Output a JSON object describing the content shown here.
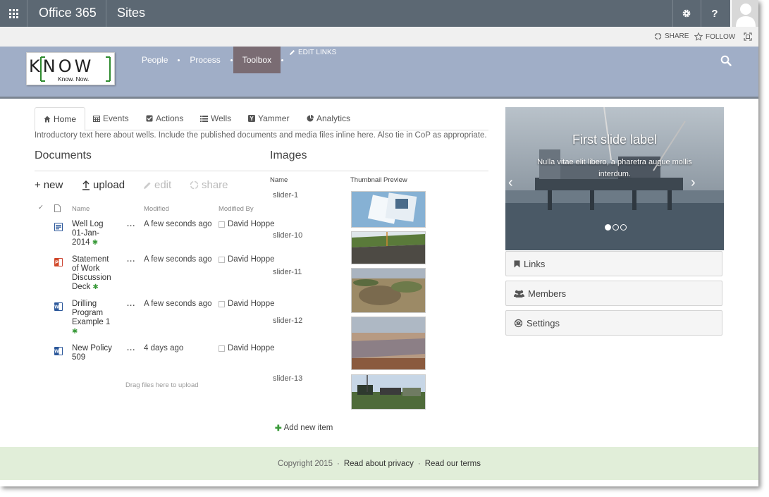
{
  "suitebar": {
    "app_name": "Office 365",
    "section": "Sites",
    "settings_icon": "gear-icon",
    "help_label": "?"
  },
  "actions": {
    "share": "SHARE",
    "follow": "FOLLOW"
  },
  "header": {
    "logo_main": "KNOW",
    "logo_tag": "Know. Now.",
    "nav": [
      "People",
      "Process",
      "Toolbox"
    ],
    "selected_nav": "Toolbox",
    "edit_links": "EDIT LINKS",
    "colors": {
      "header_bg": "#a0aec7",
      "selected_bg": "#7a6c73",
      "suitebar_bg": "#5c6873"
    }
  },
  "tabs": [
    {
      "label": "Home",
      "icon": "home-icon"
    },
    {
      "label": "Events",
      "icon": "calendar-icon"
    },
    {
      "label": "Actions",
      "icon": "checkbox-icon"
    },
    {
      "label": "Wells",
      "icon": "list-icon"
    },
    {
      "label": "Yammer",
      "icon": "yammer-icon"
    },
    {
      "label": "Analytics",
      "icon": "pie-chart-icon"
    }
  ],
  "intro": "Introductory text here about wells. Include the published documents and media files inline here. Also tie in CoP as appropriate.",
  "documents": {
    "title": "Documents",
    "commands": {
      "new": "new",
      "upload": "upload",
      "edit": "edit",
      "share": "share"
    },
    "columns": {
      "name": "Name",
      "modified": "Modified",
      "modified_by": "Modified By"
    },
    "rows": [
      {
        "name": "Well Log 01-Jan-2014",
        "type": "document",
        "modified": "A few seconds ago",
        "modified_by": "David Hoppe",
        "new": true
      },
      {
        "name": "Statement of Work Discussion Deck",
        "type": "pdf",
        "modified": "A few seconds ago",
        "modified_by": "David Hoppe",
        "new": true
      },
      {
        "name": "Drilling Program Example 1",
        "type": "word",
        "modified": "A few seconds ago",
        "modified_by": "David Hoppe",
        "new": true
      },
      {
        "name": "New Policy 509",
        "type": "word",
        "modified": "4 days ago",
        "modified_by": "David Hoppe",
        "new": false
      }
    ],
    "drag_hint": "Drag files here to upload"
  },
  "images": {
    "title": "Images",
    "columns": {
      "name": "Name",
      "thumb": "Thumbnail Preview"
    },
    "rows": [
      {
        "name": "slider-1"
      },
      {
        "name": "slider-10"
      },
      {
        "name": "slider-11"
      },
      {
        "name": "slider-12"
      },
      {
        "name": "slider-13"
      }
    ],
    "add_new": "Add new item"
  },
  "carousel": {
    "title": "First slide label",
    "caption": "Nulla vitae elit libero, a pharetra augue mollis interdum.",
    "slide_count": 3,
    "active_slide": 1
  },
  "panels": [
    {
      "label": "Links",
      "icon": "bookmark-icon"
    },
    {
      "label": "Members",
      "icon": "users-icon"
    },
    {
      "label": "Settings",
      "icon": "settings-icon"
    }
  ],
  "footer": {
    "copyright": "Copyright 2015",
    "privacy": "Read about privacy",
    "terms": "Read our terms"
  }
}
